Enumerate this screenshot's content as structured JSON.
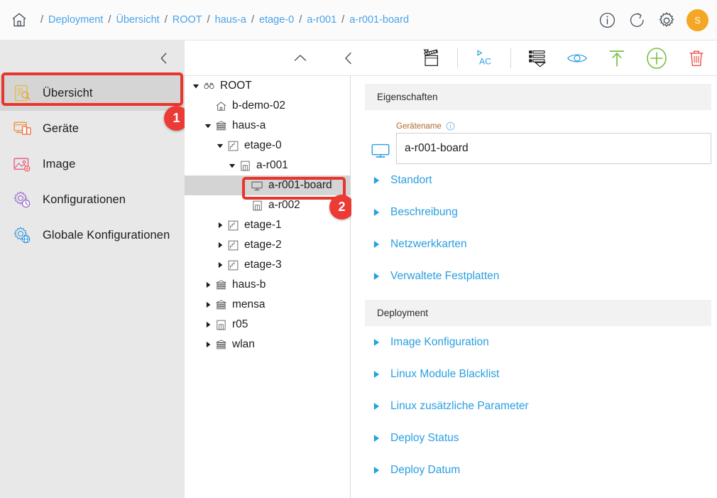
{
  "header": {
    "home_icon": "home-icon",
    "breadcrumb": [
      {
        "label": "Deployment"
      },
      {
        "label": "Übersicht"
      },
      {
        "label": "ROOT"
      },
      {
        "label": "haus-a"
      },
      {
        "label": "etage-0"
      },
      {
        "label": "a-r001"
      },
      {
        "label": "a-r001-board"
      }
    ],
    "separator": "/",
    "actions": [
      {
        "name": "info-icon",
        "title": "Info"
      },
      {
        "name": "refresh-icon",
        "title": "Refresh"
      },
      {
        "name": "gear-icon",
        "title": "Einstellungen"
      }
    ],
    "avatar_initial": "S",
    "avatar_color": "#f5a623"
  },
  "sidebar": {
    "collapse_icon": "chevron-left-icon",
    "items": [
      {
        "label": "Übersicht",
        "icon": "overview-document-search-icon",
        "active": true
      },
      {
        "label": "Geräte",
        "icon": "devices-icon",
        "active": false
      },
      {
        "label": "Image",
        "icon": "image-icon",
        "active": false
      },
      {
        "label": "Konfigurationen",
        "icon": "configurations-gear-icon",
        "active": false
      },
      {
        "label": "Globale Konfigurationen",
        "icon": "global-configurations-gear-globe-icon",
        "active": false
      }
    ],
    "background": "#e8e8e8",
    "active_background": "#d5d5d5"
  },
  "annotations": [
    {
      "number": "1",
      "target": "sidebar-item-uebersicht",
      "color": "#ec3a35"
    },
    {
      "number": "2",
      "target": "tree-node-a-r001-board",
      "color": "#ec3a35"
    }
  ],
  "toolbar": {
    "buttons": [
      {
        "name": "collapse-up-icon",
        "label": "Nach oben"
      },
      {
        "name": "back-chevron-icon",
        "label": "Zurück"
      },
      {
        "name": "clapperboard-icon",
        "label": "Aktion ausführen"
      },
      {
        "name": "ac-script-icon",
        "label": "AC"
      },
      {
        "name": "list-apply-icon",
        "label": "Liste"
      },
      {
        "name": "eye-icon",
        "label": "Anzeigen"
      },
      {
        "name": "upload-arrow-icon",
        "label": "Hochladen"
      },
      {
        "name": "plus-circle-icon",
        "label": "Hinzufügen"
      },
      {
        "name": "trash-icon",
        "label": "Löschen"
      }
    ],
    "accent_blue": "#2a9fe0",
    "accent_green": "#76c043",
    "accent_red": "#e8504a"
  },
  "tree": {
    "nodes": [
      {
        "label": "ROOT",
        "icon": "binoculars-icon",
        "depth": 0,
        "twisty": "expanded",
        "selected": false
      },
      {
        "label": "b-demo-02",
        "icon": "house-icon",
        "depth": 1,
        "twisty": "none",
        "selected": false
      },
      {
        "label": "haus-a",
        "icon": "building-icon",
        "depth": 1,
        "twisty": "expanded",
        "selected": false
      },
      {
        "label": "etage-0",
        "icon": "floorplan-icon",
        "depth": 2,
        "twisty": "expanded",
        "selected": false
      },
      {
        "label": "a-r001",
        "icon": "room-icon",
        "depth": 3,
        "twisty": "expanded",
        "selected": false
      },
      {
        "label": "a-r001-board",
        "icon": "monitor-icon",
        "depth": 4,
        "twisty": "none",
        "selected": true
      },
      {
        "label": "a-r002",
        "icon": "room-icon",
        "depth": 4,
        "twisty": "none",
        "selected": false
      },
      {
        "label": "etage-1",
        "icon": "floorplan-icon",
        "depth": 2,
        "twisty": "collapsed",
        "selected": false
      },
      {
        "label": "etage-2",
        "icon": "floorplan-icon",
        "depth": 2,
        "twisty": "collapsed",
        "selected": false
      },
      {
        "label": "etage-3",
        "icon": "floorplan-icon",
        "depth": 2,
        "twisty": "collapsed",
        "selected": false
      },
      {
        "label": "haus-b",
        "icon": "building-icon",
        "depth": 1,
        "twisty": "collapsed",
        "selected": false
      },
      {
        "label": "mensa",
        "icon": "building-icon",
        "depth": 1,
        "twisty": "collapsed",
        "selected": false
      },
      {
        "label": "r05",
        "icon": "room-icon",
        "depth": 1,
        "twisty": "collapsed",
        "selected": false
      },
      {
        "label": "wlan",
        "icon": "building-icon",
        "depth": 1,
        "twisty": "collapsed",
        "selected": false
      }
    ]
  },
  "detail": {
    "sections": [
      {
        "title": "Eigenschaften",
        "field": {
          "icon": "monitor-icon",
          "label": "Gerätename",
          "info_icon": "info-icon",
          "value": "a-r001-board",
          "placeholder": "Gerätename"
        },
        "items": [
          {
            "label": "Standort"
          },
          {
            "label": "Beschreibung"
          },
          {
            "label": "Netzwerkkarten"
          },
          {
            "label": "Verwaltete Festplatten"
          }
        ]
      },
      {
        "title": "Deployment",
        "items": [
          {
            "label": "Image Konfiguration"
          },
          {
            "label": "Linux Module Blacklist"
          },
          {
            "label": "Linux zusätzliche Parameter"
          },
          {
            "label": "Deploy Status"
          },
          {
            "label": "Deploy Datum"
          }
        ]
      }
    ],
    "link_color": "#2a9fe0",
    "label_color": "#b06a32"
  }
}
